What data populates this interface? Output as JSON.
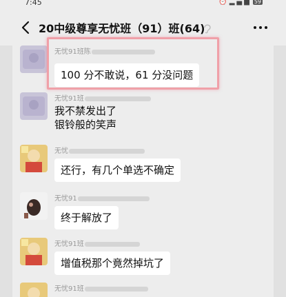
{
  "status_bar": {
    "time": "7:45",
    "battery": "59"
  },
  "header": {
    "title": "20中级尊享无忧班（91）班(64)"
  },
  "messages": [
    {
      "sender_prefix": "无忧91班陈",
      "lines": [
        "100 分不敢说，61 分没问题"
      ],
      "style": "bubble",
      "avatar": "avatar-purple"
    },
    {
      "sender_prefix": "无忧91班",
      "lines": [
        "我不禁发出了",
        "银铃般的笑声"
      ],
      "style": "plain",
      "avatar": "avatar-purple"
    },
    {
      "sender_prefix": "无忧",
      "lines": [
        "还行，有几个单选不确定"
      ],
      "style": "bubble",
      "avatar": "avatar-cartoon"
    },
    {
      "sender_prefix": "无忧91",
      "lines": [
        "终于解放了"
      ],
      "style": "bubble",
      "avatar": "avatar-dark"
    },
    {
      "sender_prefix": "无忧91班",
      "lines": [
        "增值税那个竟然掉坑了"
      ],
      "style": "bubble",
      "avatar": "avatar-cartoon"
    },
    {
      "sender_prefix": "无忧91班",
      "lines": [],
      "style": "bubble",
      "avatar": "avatar-cartoon"
    }
  ]
}
